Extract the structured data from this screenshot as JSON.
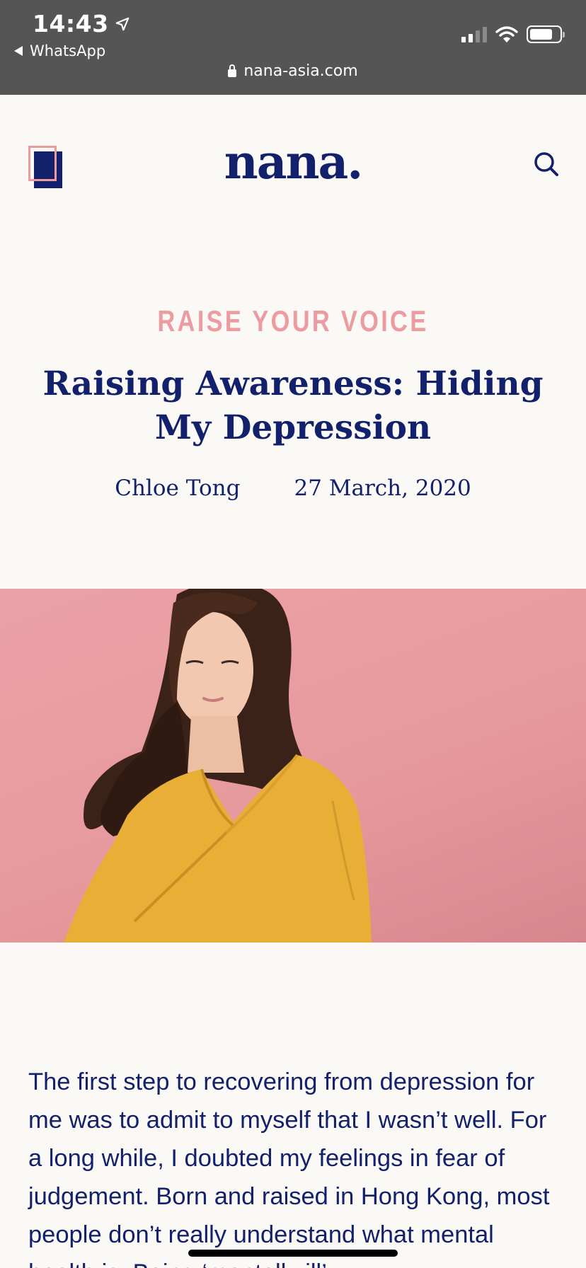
{
  "status_bar": {
    "time": "14:43",
    "back_app": "WhatsApp",
    "url": "nana-asia.com"
  },
  "site": {
    "logo": "nana."
  },
  "article": {
    "category": "RAISE YOUR VOICE",
    "title": "Raising Awareness: Hiding My Depression",
    "author": "Chloe Tong",
    "date": "27 March, 2020",
    "body": "The first step to recovering from depression for me was to admit to myself that I wasn’t well. For a long while, I doubted my feelings in fear of judgement. Born and raised in Hong Kong, most people don’t really understand what mental health is. Being ‘mentally ill’"
  },
  "colors": {
    "navy": "#13216c",
    "pink": "#ec9ba0",
    "background": "#fbf9f6",
    "status_bar": "#555555"
  },
  "icons": [
    "location-arrow-icon",
    "back-triangle-icon",
    "signal-icon",
    "wifi-icon",
    "battery-icon",
    "lock-icon",
    "menu-icon",
    "search-icon"
  ]
}
